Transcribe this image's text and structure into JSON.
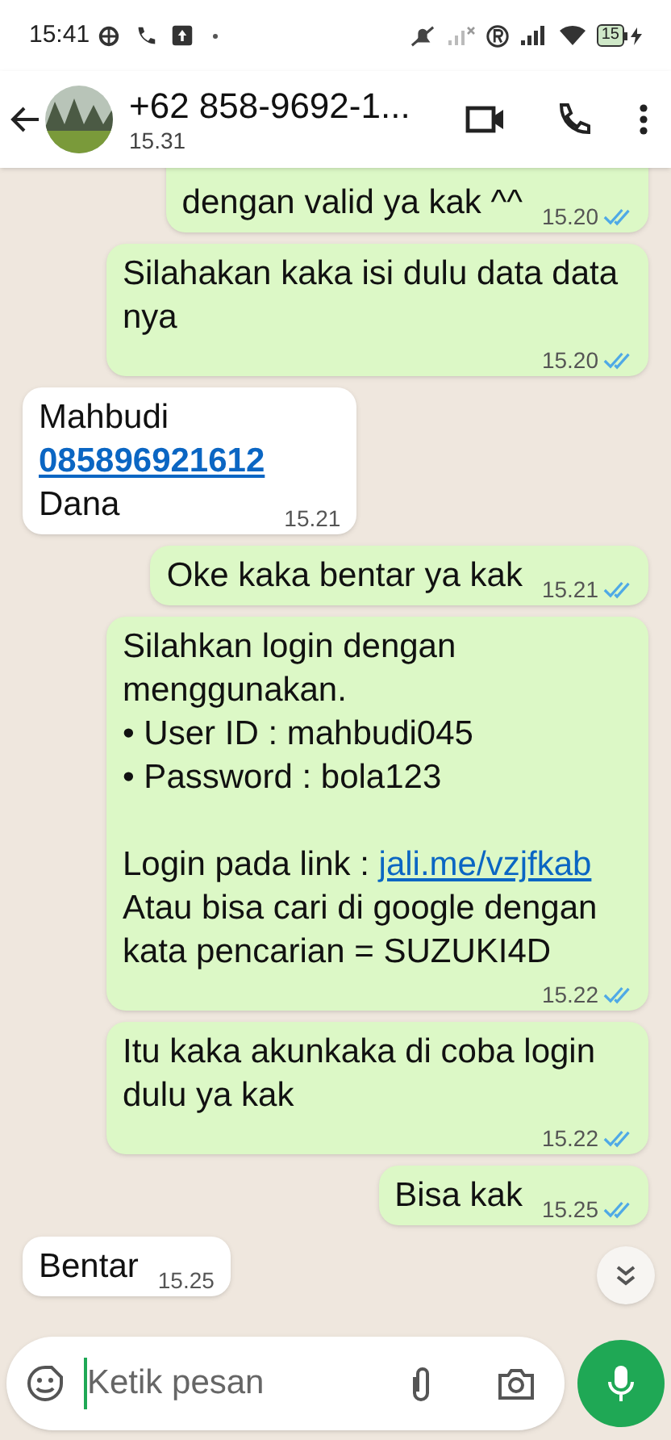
{
  "status_bar": {
    "time": "15:41",
    "battery": "15"
  },
  "header": {
    "title": "+62 858-9692-1...",
    "subtitle": "15.31"
  },
  "messages": [
    {
      "kind": "outgoing",
      "paragraphs": [
        {
          "text": "dengan valid ya kak ^^"
        }
      ],
      "time": "15.20",
      "read": true
    },
    {
      "kind": "outgoing",
      "paragraphs": [
        {
          "text": "Silahakan kaka isi dulu data data nya"
        }
      ],
      "time": "15.20",
      "read": true
    },
    {
      "kind": "incoming",
      "paragraphs": [
        {
          "text": "Mahbudi"
        },
        {
          "link": "085896921612"
        },
        {
          "text": "Dana"
        }
      ],
      "time": "15.21",
      "read": false
    },
    {
      "kind": "outgoing",
      "paragraphs": [
        {
          "text": "Oke kaka bentar ya kak"
        }
      ],
      "time": "15.21",
      "read": true
    },
    {
      "kind": "outgoing",
      "paragraphs": [
        {
          "text": "Silahkan login dengan menggunakan."
        },
        {
          "text": "• User ID : mahbudi045"
        },
        {
          "text": "• Password : bola123"
        },
        {
          "text": "Login pada link : ",
          "link": "jali.me/vzjfkab",
          "gap_before": true
        },
        {
          "text": "Atau bisa cari di google dengan kata pencarian = SUZUKI4D"
        }
      ],
      "time": "15.22",
      "read": true
    },
    {
      "kind": "outgoing",
      "paragraphs": [
        {
          "text": "Itu kaka akunkaka di coba login dulu ya kak"
        }
      ],
      "time": "15.22",
      "read": true
    },
    {
      "kind": "outgoing",
      "paragraphs": [
        {
          "text": "Bisa kak"
        }
      ],
      "time": "15.25",
      "read": true
    },
    {
      "kind": "incoming",
      "paragraphs": [
        {
          "text": "Bentar"
        }
      ],
      "time": "15.25",
      "read": false
    }
  ],
  "composer": {
    "placeholder": "Ketik pesan"
  }
}
